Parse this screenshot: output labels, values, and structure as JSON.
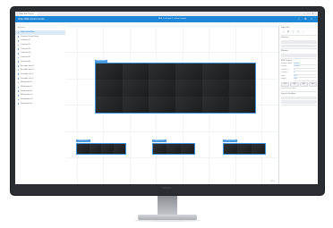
{
  "browser": {
    "tab_label": "Video Wall Control",
    "window_controls": [
      "–",
      "□",
      "×"
    ]
  },
  "appbar": {
    "title": "Video Wall Control Center",
    "center_info": "Wall 1 ▾   Scene 1 ▾   Save Layout",
    "controls": [
      "⛶",
      "⚙",
      "×"
    ]
  },
  "sidebar": {
    "header": "Screens",
    "add_label": "+",
    "items": [
      {
        "label": "Video Wall Main",
        "active": true
      },
      {
        "label": "Camera Group Entry",
        "active": false
      },
      {
        "label": "Camera 01",
        "active": false
      },
      {
        "label": "Camera 02",
        "active": false
      },
      {
        "label": "Camera 03",
        "active": false
      },
      {
        "label": "Camera 04",
        "active": false
      },
      {
        "label": "Camera 05",
        "active": false
      },
      {
        "label": "Camera 06",
        "active": false
      },
      {
        "label": "Encoder Input 1",
        "active": false
      },
      {
        "label": "Encoder Input 2",
        "active": false
      },
      {
        "label": "Decoder Out 1",
        "active": false
      },
      {
        "label": "Decoder Out 2",
        "active": false
      },
      {
        "label": "Workstation 1",
        "active": false
      },
      {
        "label": "Workstation 2",
        "active": false
      },
      {
        "label": "Workstation 3",
        "active": false
      },
      {
        "label": "Workstation 4",
        "active": false
      },
      {
        "label": "Workstation 5",
        "active": false
      },
      {
        "label": "Workstation 6",
        "active": false
      }
    ]
  },
  "canvas": {
    "main_wall_label": "Video Wall 1",
    "wall_a_label": "Display Wall 2",
    "wall_b_label": "Display Wall 3",
    "wall_c_label": "Display Wall 4",
    "scroll_note": "100%"
  },
  "right_panel": {
    "section1_title": "Page Edit",
    "section2_title": "Screens",
    "section3_title": "Window",
    "section4_title": "Wall Display",
    "fields": [
      {
        "key": "Window Name",
        "value": "Window"
      },
      {
        "key": "Source",
        "value": "Camera"
      },
      {
        "key": "Position X",
        "value": "0"
      },
      {
        "key": "Position Y",
        "value": "0"
      },
      {
        "key": "Width",
        "value": "1920"
      },
      {
        "key": "Height",
        "value": "1080"
      }
    ],
    "buttons": [
      "1x1",
      "2x2",
      "3x3",
      "4x4"
    ],
    "option_text": "Lock Screen Layout",
    "section5_title": "Source Info Area"
  },
  "colors": {
    "accent": "#1e86d6",
    "selection": "#3a8fd8"
  }
}
